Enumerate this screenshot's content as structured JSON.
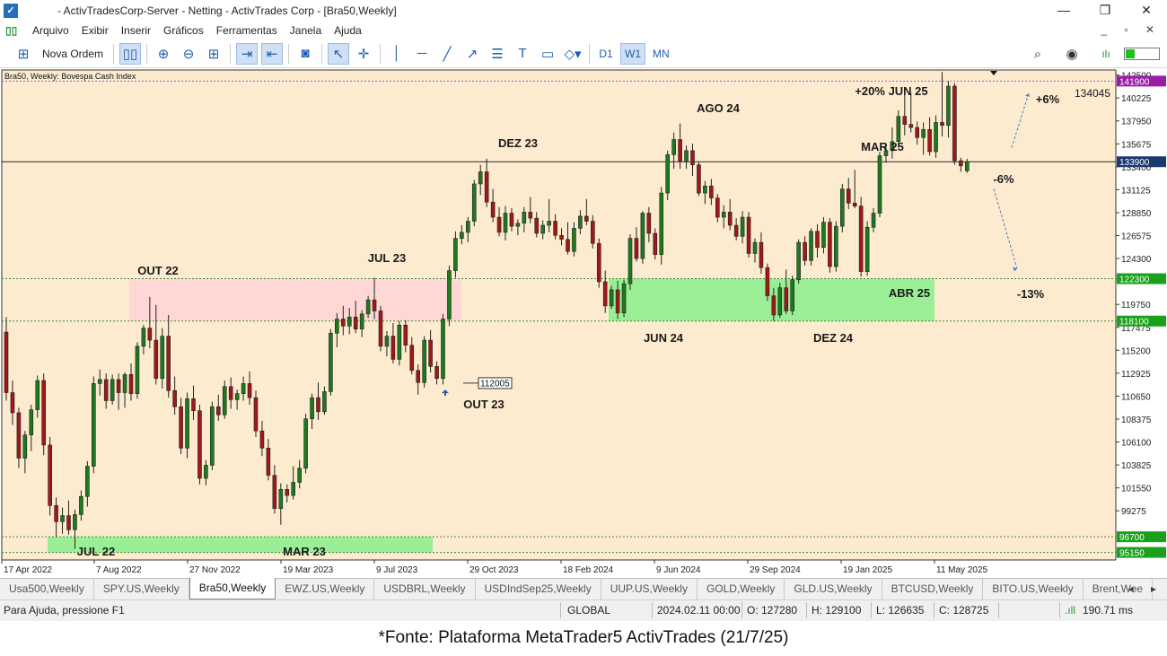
{
  "window": {
    "title": " - ActivTradesCorp-Server - Netting - ActivTrades Corp - [Bra50,Weekly]",
    "controls": [
      "—",
      "❐",
      "✕"
    ]
  },
  "menu": {
    "items": [
      "Arquivo",
      "Exibir",
      "Inserir",
      "Gráficos",
      "Ferramentas",
      "Janela",
      "Ajuda"
    ],
    "mdi_controls": "_ ▫ ✕"
  },
  "toolbar": {
    "new_order_label": "Nova Ordem",
    "timeframes": [
      "D1",
      "W1",
      "MN"
    ],
    "selected_timeframe": "W1",
    "icons": [
      "new-order-icon",
      "chart-type-icon",
      "zoom-in-icon",
      "zoom-out-icon",
      "grid-icon",
      "autoscroll-icon",
      "chart-shift-icon",
      "screenshot-icon",
      "cursor-icon",
      "crosshair-icon",
      "vertical-line-icon",
      "horizontal-line-icon",
      "trendline-icon",
      "ray-icon",
      "channel-icon",
      "text-icon",
      "rectangle-icon",
      "shapes-icon",
      "search-icon",
      "account-icon",
      "signal-icon"
    ]
  },
  "chart_data": {
    "type": "candlestick",
    "symbol_label": "Bra50, Weekly:  Bovespa Cash Index",
    "ylim": [
      94400,
      143000
    ],
    "y_ticks": [
      142500,
      140225,
      137950,
      135675,
      133400,
      131125,
      128850,
      126575,
      124300,
      119750,
      117475,
      115200,
      112925,
      110650,
      108375,
      106100,
      103825,
      101550,
      99275
    ],
    "x_ticks": [
      "17 Apr 2022",
      "7 Aug 2022",
      "27 Nov 2022",
      "19 Mar 2023",
      "9 Jul 2023",
      "29 Oct 2023",
      "18 Feb 2024",
      "9 Jun 2024",
      "29 Sep 2024",
      "19 Jan 2025",
      "11 May 2025"
    ],
    "price_tags": [
      {
        "value": 141900,
        "bg": "#9a1ea4",
        "style": "dotted",
        "color": "#b050c0"
      },
      {
        "value": 133900,
        "bg": "#1a3a6e",
        "style": "solid",
        "color": "#2a2a2a"
      },
      {
        "value": 122300,
        "bg": "#1aa01a",
        "style": "dotted",
        "color": "#3a8a3a"
      },
      {
        "value": 118100,
        "bg": "#1aa01a",
        "style": "dotted",
        "color": "#3a8a3a"
      },
      {
        "value": 96700,
        "bg": "#1aa01a",
        "style": "dotted",
        "color": "#3a8a3a"
      },
      {
        "value": 95150,
        "bg": "#1aa01a",
        "style": "dotted",
        "color": "#3a8a3a"
      }
    ],
    "zones": [
      {
        "x0": 0.07,
        "x1": 0.66,
        "y0": 95150,
        "y1": 96700,
        "color": "#8ff08f"
      },
      {
        "x0": 0.182,
        "x1": 0.658,
        "y0": 118100,
        "y1": 122300,
        "color": "#ffd6d6"
      },
      {
        "x0": 0.869,
        "x1": 1.33,
        "y0": 118100,
        "y1": 122300,
        "color": "#8ff08f"
      }
    ],
    "annotations": [
      {
        "text": "OUT 22",
        "xi": 34.5,
        "y": 121500
      },
      {
        "text": "JUL 23",
        "xi": 82.5,
        "y": 123800
      },
      {
        "text": "DEZ 23",
        "xi": 110.5,
        "y": 135600
      },
      {
        "text": "AGO 24",
        "xi": 153.5,
        "y": 139000
      },
      {
        "text": "+20% JUN 25",
        "xi": 191,
        "y": 140700
      },
      {
        "text": "MAR 25",
        "xi": 189,
        "y": 135400
      },
      {
        "text": "+6%",
        "xi": 224,
        "y": 139600
      },
      {
        "text": "134045",
        "xi": 234,
        "y": 139800
      },
      {
        "text": "-6%",
        "xi": 215,
        "y": 131700
      },
      {
        "text": "-13%",
        "xi": 225,
        "y": 120300
      },
      {
        "text": "ABR 25",
        "xi": 195,
        "y": 120700
      },
      {
        "text": "JUN 24",
        "xi": 142,
        "y": 116500
      },
      {
        "text": "DEZ 24",
        "xi": 179,
        "y": 116500
      },
      {
        "text": "OUT 23",
        "xi": 104,
        "y": 110200
      },
      {
        "text": "JUL 22",
        "xi": 20.5,
        "y": 95500
      },
      {
        "text": "MAR 23",
        "xi": 65.5,
        "y": 95500
      }
    ],
    "last_price_label": "112005",
    "candles": [
      [
        117000,
        118500,
        110200,
        111000
      ],
      [
        111000,
        112200,
        107800,
        109000
      ],
      [
        109000,
        109500,
        103500,
        104500
      ],
      [
        104500,
        107200,
        103000,
        106800
      ],
      [
        106800,
        109800,
        105200,
        109300
      ],
      [
        109300,
        112700,
        108500,
        112200
      ],
      [
        112200,
        112900,
        104800,
        105800
      ],
      [
        105800,
        106600,
        98800,
        99800
      ],
      [
        99800,
        100600,
        96700,
        98200
      ],
      [
        98200,
        99600,
        97000,
        98800
      ],
      [
        98800,
        100300,
        96900,
        97400
      ],
      [
        97400,
        99400,
        95500,
        98900
      ],
      [
        98900,
        101300,
        98300,
        100700
      ],
      [
        100700,
        104200,
        99700,
        103700
      ],
      [
        103700,
        112600,
        103000,
        111900
      ],
      [
        111900,
        113300,
        110700,
        112300
      ],
      [
        112300,
        112900,
        109400,
        110200
      ],
      [
        110200,
        112800,
        109800,
        112300
      ],
      [
        112300,
        112900,
        109300,
        111000
      ],
      [
        111000,
        113000,
        109500,
        112800
      ],
      [
        112800,
        113900,
        110200,
        110900
      ],
      [
        110900,
        116000,
        110400,
        115600
      ],
      [
        115600,
        117700,
        114800,
        117400
      ],
      [
        117400,
        120500,
        115400,
        116200
      ],
      [
        116200,
        119700,
        111800,
        112400
      ],
      [
        112400,
        117400,
        111400,
        116600
      ],
      [
        116600,
        118700,
        110500,
        111200
      ],
      [
        111200,
        112600,
        108800,
        109600
      ],
      [
        109600,
        110500,
        104900,
        105500
      ],
      [
        105500,
        111000,
        104500,
        110400
      ],
      [
        110400,
        111700,
        108300,
        109200
      ],
      [
        109200,
        109800,
        101900,
        102500
      ],
      [
        102500,
        104300,
        101800,
        103800
      ],
      [
        103800,
        110100,
        103300,
        109600
      ],
      [
        109600,
        110800,
        108200,
        108800
      ],
      [
        108800,
        112200,
        108400,
        111600
      ],
      [
        111600,
        112500,
        109400,
        110300
      ],
      [
        110300,
        111300,
        109300,
        110900
      ],
      [
        110900,
        112600,
        110200,
        111900
      ],
      [
        111900,
        113100,
        109800,
        110500
      ],
      [
        110500,
        111200,
        106600,
        107200
      ],
      [
        107200,
        108200,
        104700,
        105500
      ],
      [
        105500,
        106400,
        102300,
        102800
      ],
      [
        102800,
        103800,
        99000,
        99500
      ],
      [
        99500,
        102000,
        97900,
        101400
      ],
      [
        101400,
        101900,
        100100,
        100800
      ],
      [
        100800,
        103700,
        100400,
        102100
      ],
      [
        102100,
        104300,
        101500,
        103500
      ],
      [
        103500,
        108900,
        103000,
        108400
      ],
      [
        108400,
        110900,
        107400,
        110500
      ],
      [
        110500,
        112000,
        108300,
        109100
      ],
      [
        109100,
        111600,
        108800,
        111100
      ],
      [
        111100,
        117300,
        110700,
        116900
      ],
      [
        116900,
        118900,
        115500,
        118300
      ],
      [
        118300,
        119600,
        116700,
        117600
      ],
      [
        117600,
        119400,
        116800,
        118500
      ],
      [
        118500,
        120100,
        116900,
        117300
      ],
      [
        117300,
        119200,
        116500,
        118800
      ],
      [
        118800,
        120600,
        118400,
        120200
      ],
      [
        120200,
        122400,
        118300,
        119100
      ],
      [
        119100,
        119600,
        115100,
        115600
      ],
      [
        115600,
        117100,
        114600,
        116600
      ],
      [
        116600,
        117900,
        113900,
        114300
      ],
      [
        114300,
        118100,
        113700,
        117700
      ],
      [
        117700,
        118200,
        115000,
        115700
      ],
      [
        115700,
        116500,
        112800,
        113200
      ],
      [
        113200,
        113800,
        110800,
        112000
      ],
      [
        112000,
        116600,
        111500,
        116200
      ],
      [
        116200,
        117200,
        113000,
        113600
      ],
      [
        113600,
        114100,
        111800,
        112400
      ],
      [
        112400,
        118800,
        111800,
        118300
      ],
      [
        118300,
        123600,
        117600,
        123100
      ],
      [
        123100,
        127000,
        122400,
        126300
      ],
      [
        126300,
        127600,
        125700,
        126900
      ],
      [
        126900,
        128400,
        125900,
        128000
      ],
      [
        128000,
        132100,
        127500,
        131700
      ],
      [
        131700,
        133600,
        130600,
        132900
      ],
      [
        132900,
        134200,
        129400,
        129900
      ],
      [
        129900,
        131200,
        127900,
        128400
      ],
      [
        128400,
        129400,
        126500,
        126900
      ],
      [
        126900,
        129500,
        126100,
        128800
      ],
      [
        128800,
        129300,
        127000,
        127500
      ],
      [
        127500,
        128200,
        126600,
        127800
      ],
      [
        127800,
        129400,
        126900,
        128900
      ],
      [
        128900,
        130400,
        127800,
        128300
      ],
      [
        128300,
        128900,
        126400,
        126800
      ],
      [
        126800,
        128100,
        126200,
        127600
      ],
      [
        127600,
        130200,
        126900,
        128000
      ],
      [
        128000,
        128700,
        126200,
        126600
      ],
      [
        126600,
        127300,
        125600,
        126200
      ],
      [
        126200,
        127900,
        124700,
        125000
      ],
      [
        125000,
        127900,
        124500,
        127300
      ],
      [
        127300,
        129100,
        126700,
        128500
      ],
      [
        128500,
        130200,
        127600,
        128000
      ],
      [
        128000,
        128600,
        125300,
        125800
      ],
      [
        125800,
        126300,
        121400,
        122000
      ],
      [
        122000,
        123100,
        118900,
        119600
      ],
      [
        119600,
        121600,
        119300,
        121200
      ],
      [
        121200,
        122100,
        118300,
        118900
      ],
      [
        118900,
        122200,
        118500,
        121800
      ],
      [
        121800,
        126700,
        121200,
        126300
      ],
      [
        126300,
        127400,
        124000,
        124300
      ],
      [
        124300,
        129000,
        123800,
        128800
      ],
      [
        128800,
        129400,
        125900,
        126800
      ],
      [
        126800,
        127300,
        124200,
        124700
      ],
      [
        124700,
        131400,
        123700,
        130800
      ],
      [
        130800,
        135000,
        130100,
        134600
      ],
      [
        134600,
        136800,
        133200,
        136100
      ],
      [
        136100,
        137700,
        133200,
        133900
      ],
      [
        133900,
        135500,
        133200,
        135000
      ],
      [
        135000,
        135700,
        132500,
        133600
      ],
      [
        133600,
        133900,
        130500,
        130800
      ],
      [
        130800,
        132000,
        129700,
        131500
      ],
      [
        131500,
        132200,
        129600,
        130300
      ],
      [
        130300,
        130700,
        127900,
        128400
      ],
      [
        128400,
        129600,
        127300,
        128900
      ],
      [
        128900,
        130200,
        127100,
        127600
      ],
      [
        127600,
        128300,
        126100,
        126500
      ],
      [
        126500,
        129000,
        125800,
        128400
      ],
      [
        128400,
        128900,
        124400,
        124800
      ],
      [
        124800,
        126300,
        123900,
        125900
      ],
      [
        125900,
        126900,
        122800,
        123400
      ],
      [
        123400,
        123800,
        120100,
        120600
      ],
      [
        120600,
        121400,
        118100,
        118700
      ],
      [
        118700,
        121900,
        118400,
        121400
      ],
      [
        121400,
        123200,
        118800,
        119100
      ],
      [
        119100,
        122600,
        118700,
        122200
      ],
      [
        122200,
        126200,
        121800,
        125900
      ],
      [
        125900,
        126500,
        123600,
        124100
      ],
      [
        124100,
        127300,
        123600,
        127000
      ],
      [
        127000,
        127700,
        124400,
        125400
      ],
      [
        125400,
        128400,
        124800,
        127900
      ],
      [
        127900,
        128300,
        122900,
        123500
      ],
      [
        123500,
        128000,
        123000,
        127500
      ],
      [
        127500,
        131700,
        126900,
        131200
      ],
      [
        131200,
        132300,
        129200,
        129800
      ],
      [
        129800,
        133100,
        129300,
        129500
      ],
      [
        129500,
        130400,
        122500,
        123000
      ],
      [
        123000,
        128000,
        122600,
        127400
      ],
      [
        127400,
        129300,
        126900,
        128800
      ],
      [
        128800,
        134900,
        128400,
        134500
      ],
      [
        134500,
        135700,
        133800,
        135000
      ],
      [
        135000,
        137300,
        134200,
        135900
      ],
      [
        135900,
        139000,
        135300,
        138400
      ],
      [
        138400,
        140700,
        136500,
        137600
      ],
      [
        137600,
        140700,
        136800,
        137300
      ],
      [
        137300,
        137900,
        135600,
        136300
      ],
      [
        136300,
        137800,
        134600,
        137100
      ],
      [
        137100,
        138300,
        134500,
        134900
      ],
      [
        134900,
        138500,
        134300,
        137800
      ],
      [
        137800,
        142800,
        136400,
        137500
      ],
      [
        137500,
        141900,
        136300,
        141400
      ],
      [
        141400,
        141700,
        133600,
        134000
      ],
      [
        134000,
        134300,
        132900,
        133500
      ],
      [
        133000,
        134200,
        132800,
        133900
      ]
    ]
  },
  "tabs": [
    "Usa500,Weekly",
    "SPY.US,Weekly",
    "Bra50,Weekly",
    "EWZ.US,Weekly",
    "USDBRL,Weekly",
    "USDIndSep25,Weekly",
    "UUP.US,Weekly",
    "GOLD,Weekly",
    "GLD.US,Weekly",
    "BTCUSD,Weekly",
    "BITO.US,Weekly",
    "Brent,Wee"
  ],
  "active_tab": "Bra50,Weekly",
  "status": {
    "help": "Para Ajuda, pressione F1",
    "profile": "GLOBAL",
    "datetime": "2024.02.11 00:00",
    "open": "O: 127280",
    "high": "H: 129100",
    "low": "L: 126635",
    "close": "C: 128725",
    "ping": "190.71 ms"
  },
  "caption": "*Fonte: Plataforma MetaTrader5 ActivTrades (21/7/25)",
  "colors": {
    "chart_bg": "#fdebcf",
    "bull": "#1c7a1c",
    "bear": "#a01818",
    "accent": "#1d5fae"
  }
}
